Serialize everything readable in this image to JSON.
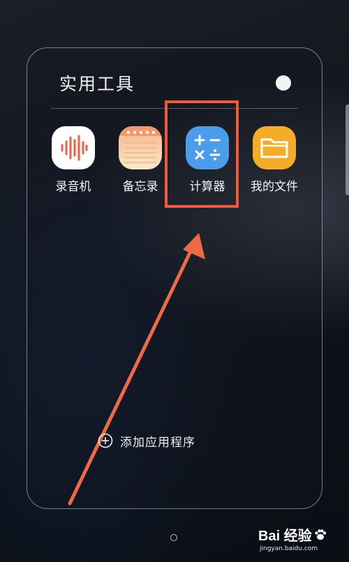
{
  "folder": {
    "title": "实用工具",
    "apps": [
      {
        "label": "录音机",
        "icon": "voice-recorder-icon"
      },
      {
        "label": "备忘录",
        "icon": "memo-notepad-icon"
      },
      {
        "label": "计算器",
        "icon": "calculator-icon"
      },
      {
        "label": "我的文件",
        "icon": "folder-files-icon"
      }
    ],
    "add_app_label": "添加应用程序",
    "color_dot": "#f4f4f4"
  },
  "annotation": {
    "highlight_color": "#ee5a3a",
    "highlighted_app": "计算器"
  },
  "watermark": {
    "logo": "Bai 经验",
    "url": "jingyan.baidu.com"
  },
  "colors": {
    "recorder_wave": "#e9614a",
    "memo_top": "#f7b489",
    "calculator": "#4c9de9",
    "files": "#f5ad27"
  }
}
